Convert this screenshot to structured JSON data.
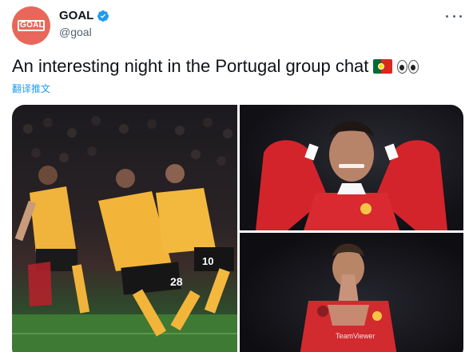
{
  "account": {
    "display_name": "GOAL",
    "handle": "@goal",
    "avatar_text": "GOAL"
  },
  "tweet": {
    "text": "An interesting night in the Portugal group chat",
    "translate_label": "翻译推文"
  },
  "icons": {
    "verified": "verified-badge-icon",
    "more": "more-options-icon",
    "flag": "portugal-flag-emoji",
    "eyes": "eyes-emoji"
  },
  "colors": {
    "accent": "#1d9bf0",
    "avatar_bg": "#e9675a",
    "text": "#0f1419",
    "secondary": "#536471"
  }
}
